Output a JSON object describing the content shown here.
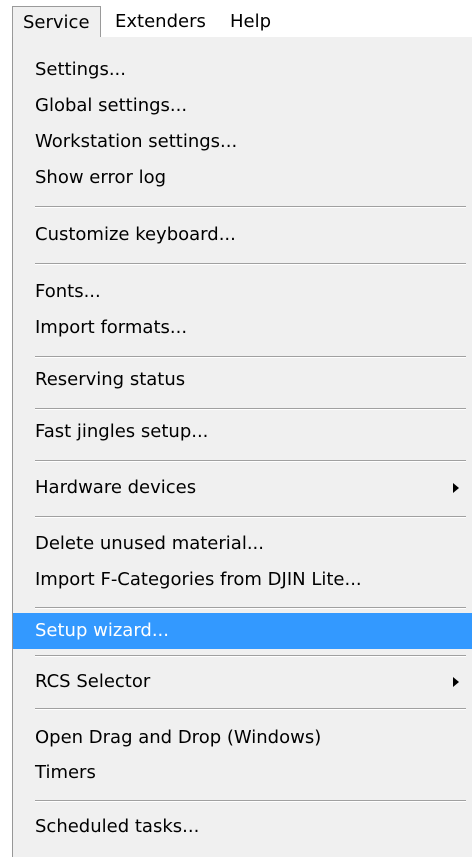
{
  "menubar": {
    "items": [
      {
        "label": "Service",
        "open": true
      },
      {
        "label": "Extenders",
        "open": false
      },
      {
        "label": "Help",
        "open": false
      }
    ]
  },
  "menu": {
    "items": [
      {
        "label": "Settings..."
      },
      {
        "label": "Global settings..."
      },
      {
        "label": "Workstation settings..."
      },
      {
        "label": "Show error log"
      },
      {
        "label": "Customize keyboard..."
      },
      {
        "label": "Fonts..."
      },
      {
        "label": "Import formats..."
      },
      {
        "label": "Reserving status"
      },
      {
        "label": "Fast jingles setup..."
      },
      {
        "label": "Hardware devices",
        "submenu": true
      },
      {
        "label": "Delete unused material..."
      },
      {
        "label": "Import F-Categories from DJIN Lite..."
      },
      {
        "label": "Setup wizard...",
        "highlighted": true
      },
      {
        "label": "RCS Selector",
        "submenu": true
      },
      {
        "label": "Open Drag and Drop (Windows)"
      },
      {
        "label": "Timers"
      },
      {
        "label": "Scheduled tasks..."
      }
    ]
  },
  "colors": {
    "menu_background": "#f0f0f0",
    "highlight": "#3399ff",
    "highlight_text": "#ffffff",
    "separator": "#a0a0a0"
  }
}
